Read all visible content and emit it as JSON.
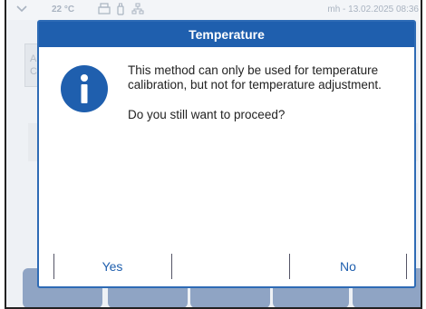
{
  "status_bar": {
    "temperature": "22 °C",
    "user_datetime": "mh - 13.02.2025 08:36",
    "icons": [
      "chevron-down-icon",
      "printer-icon",
      "usb-icon",
      "network-icon"
    ]
  },
  "background": {
    "panel_letters": "A\nC"
  },
  "dialog": {
    "title": "Temperature",
    "icon": "info-icon",
    "message_line1": "This method can only be used for temperature calibration, but not for temperature adjustment.",
    "message_line2": "Do you still want to proceed?",
    "yes_label": "Yes",
    "no_label": "No"
  },
  "colors": {
    "dialog_header": "#1f5fae",
    "button_text": "#1f5fae",
    "bottom_buttons": "#8fa4c4"
  }
}
